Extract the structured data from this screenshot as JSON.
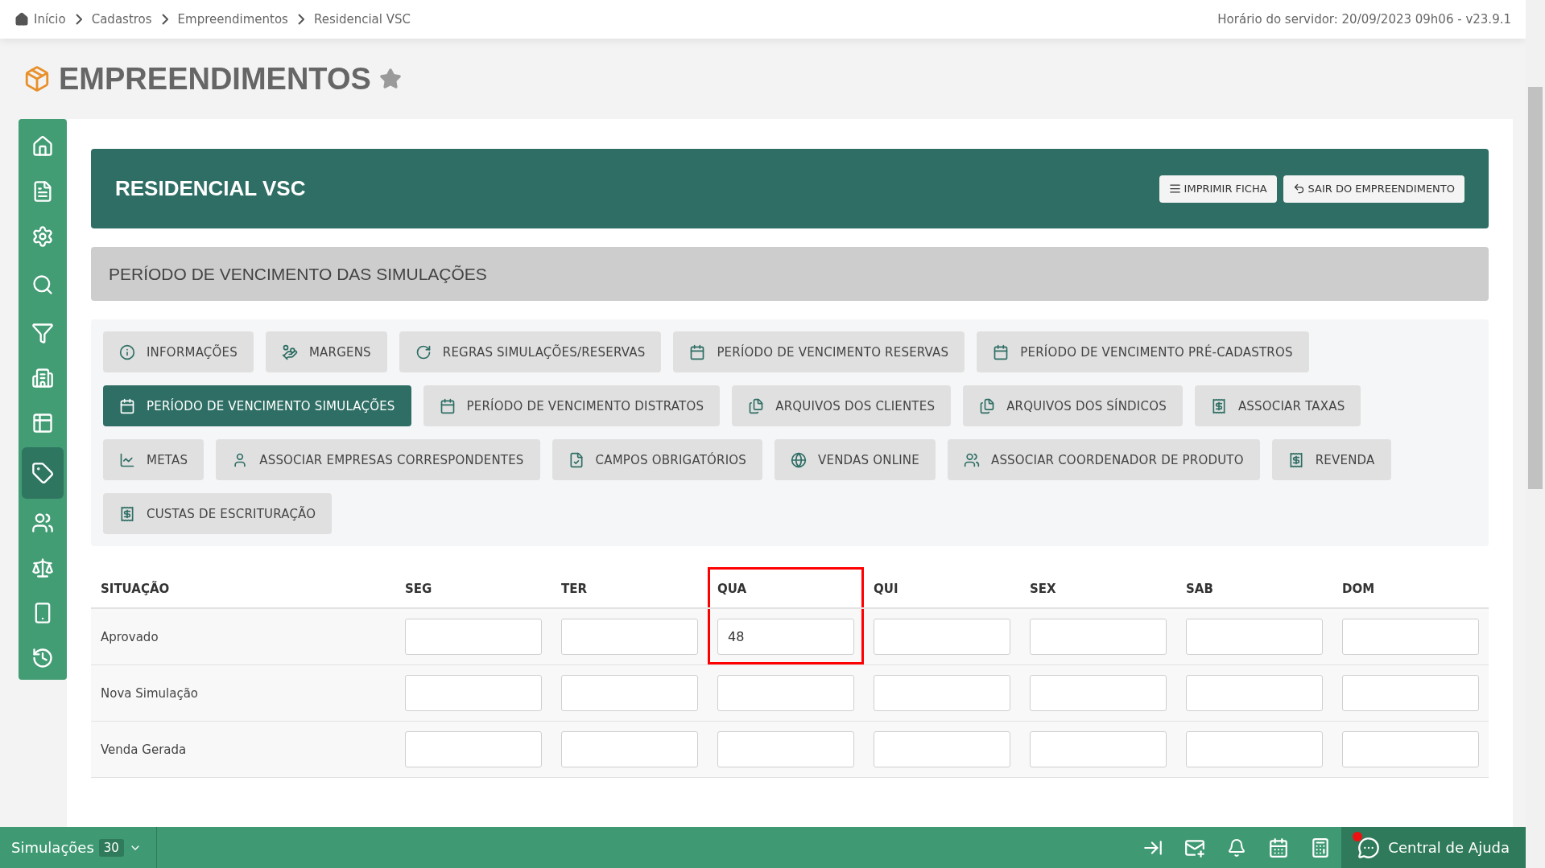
{
  "breadcrumb": [
    {
      "label": "Início"
    },
    {
      "label": "Cadastros"
    },
    {
      "label": "Empreendimentos"
    },
    {
      "label": "Residencial VSC"
    }
  ],
  "server_time": "Horário do servidor: 20/09/2023 09h06 - v23.9.1",
  "page_title": "EMPREENDIMENTOS",
  "sidebar": {
    "items": [
      {
        "selected": false
      },
      {
        "selected": false
      },
      {
        "selected": false
      },
      {
        "selected": false
      },
      {
        "selected": false
      },
      {
        "selected": false
      },
      {
        "selected": false
      },
      {
        "selected": true
      },
      {
        "selected": false
      },
      {
        "selected": false
      },
      {
        "selected": false
      },
      {
        "selected": false
      }
    ]
  },
  "header": {
    "title": "RESIDENCIAL VSC",
    "buttons": [
      "IMPRIMIR FICHA",
      "SAIR DO EMPREENDIMENTO"
    ]
  },
  "section_title": "PERÍODO DE VENCIMENTO DAS SIMULAÇÕES",
  "menu_rows": [
    [
      {
        "label": "INFORMAÇÕES",
        "selected": false
      },
      {
        "label": "MARGENS",
        "selected": false
      },
      {
        "label": "REGRAS SIMULAÇÕES/RESERVAS",
        "selected": false
      },
      {
        "label": "PERÍODO DE VENCIMENTO RESERVAS",
        "selected": false
      },
      {
        "label": "PERÍODO DE VENCIMENTO PRÉ-CADASTROS",
        "selected": false
      }
    ],
    [
      {
        "label": "PERÍODO DE VENCIMENTO SIMULAÇÕES",
        "selected": true
      },
      {
        "label": "PERÍODO DE VENCIMENTO DISTRATOS",
        "selected": false
      },
      {
        "label": "ARQUIVOS DOS CLIENTES",
        "selected": false
      },
      {
        "label": "ARQUIVOS DOS SÍNDICOS",
        "selected": false
      },
      {
        "label": "ASSOCIAR TAXAS",
        "selected": false
      }
    ],
    [
      {
        "label": "METAS",
        "selected": false
      },
      {
        "label": "ASSOCIAR EMPRESAS CORRESPONDENTES",
        "selected": false
      },
      {
        "label": "CAMPOS OBRIGATÓRIOS",
        "selected": false
      },
      {
        "label": "VENDAS ONLINE",
        "selected": false
      },
      {
        "label": "ASSOCIAR COORDENADOR DE PRODUTO",
        "selected": false
      },
      {
        "label": "REVENDA",
        "selected": false
      }
    ],
    [
      {
        "label": "CUSTAS DE ESCRITURAÇÃO",
        "selected": false
      }
    ]
  ],
  "table": {
    "columns": [
      {
        "label": "SITUAÇÃO",
        "highlighted": false
      },
      {
        "label": "SEG",
        "highlighted": false
      },
      {
        "label": "TER",
        "highlighted": false
      },
      {
        "label": "QUA",
        "highlighted": true
      },
      {
        "label": "QUI",
        "highlighted": false
      },
      {
        "label": "SEX",
        "highlighted": false
      },
      {
        "label": "SAB",
        "highlighted": false
      },
      {
        "label": "DOM",
        "highlighted": false
      }
    ],
    "rows": [
      {
        "cells": [
          {
            "kind": "label",
            "value": "Aprovado"
          },
          {
            "kind": "input"
          },
          {
            "kind": "input"
          },
          {
            "kind": "input",
            "value": "48"
          },
          {
            "kind": "input"
          },
          {
            "kind": "input"
          },
          {
            "kind": "input"
          },
          {
            "kind": "input"
          }
        ]
      },
      {
        "cells": [
          {
            "kind": "label",
            "value": "Nova Simulação"
          },
          {
            "kind": "input"
          },
          {
            "kind": "input"
          },
          {
            "kind": "input"
          },
          {
            "kind": "input"
          },
          {
            "kind": "input"
          },
          {
            "kind": "input"
          },
          {
            "kind": "input"
          }
        ]
      },
      {
        "cells": [
          {
            "kind": "label",
            "value": "Venda Gerada"
          },
          {
            "kind": "input"
          },
          {
            "kind": "input"
          },
          {
            "kind": "input"
          },
          {
            "kind": "input"
          },
          {
            "kind": "input"
          },
          {
            "kind": "input"
          },
          {
            "kind": "input"
          }
        ]
      }
    ]
  },
  "status_bar": {
    "label": "Simulações",
    "count": "30",
    "help": "Central de Ajuda"
  }
}
